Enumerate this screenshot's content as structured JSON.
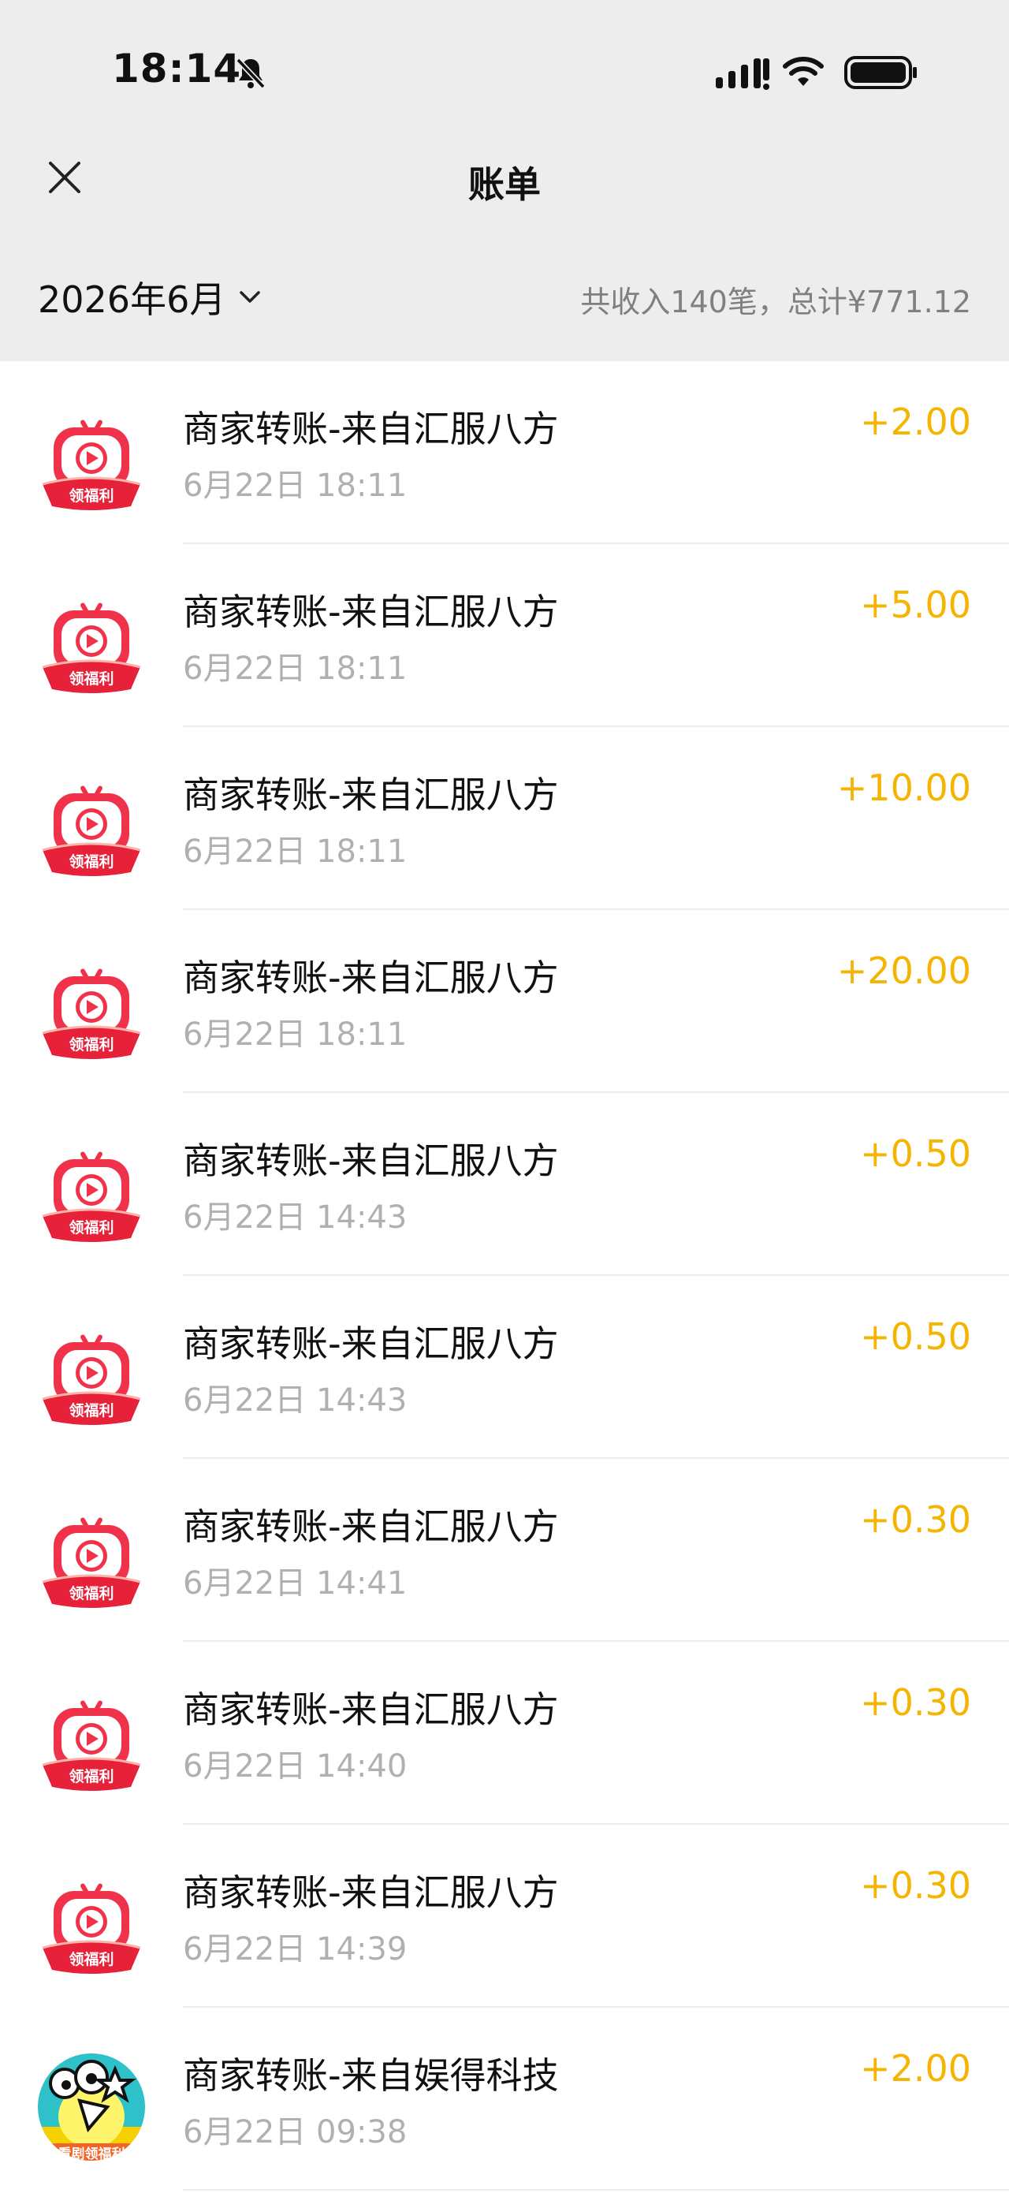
{
  "status_bar": {
    "time": "18:14"
  },
  "header": {
    "title": "账单"
  },
  "filter": {
    "month": "2026年6月",
    "summary": "共收入140笔，总计¥771.12"
  },
  "transactions": [
    {
      "title": "商家转账-来自汇服八方",
      "datetime": "6月22日 18:11",
      "amount": "+2.00",
      "avatar": "red-play-badge",
      "badge": "领福利"
    },
    {
      "title": "商家转账-来自汇服八方",
      "datetime": "6月22日 18:11",
      "amount": "+5.00",
      "avatar": "red-play-badge",
      "badge": "领福利"
    },
    {
      "title": "商家转账-来自汇服八方",
      "datetime": "6月22日 18:11",
      "amount": "+10.00",
      "avatar": "red-play-badge",
      "badge": "领福利"
    },
    {
      "title": "商家转账-来自汇服八方",
      "datetime": "6月22日 18:11",
      "amount": "+20.00",
      "avatar": "red-play-badge",
      "badge": "领福利"
    },
    {
      "title": "商家转账-来自汇服八方",
      "datetime": "6月22日 14:43",
      "amount": "+0.50",
      "avatar": "red-play-badge",
      "badge": "领福利"
    },
    {
      "title": "商家转账-来自汇服八方",
      "datetime": "6月22日 14:43",
      "amount": "+0.50",
      "avatar": "red-play-badge",
      "badge": "领福利"
    },
    {
      "title": "商家转账-来自汇服八方",
      "datetime": "6月22日 14:41",
      "amount": "+0.30",
      "avatar": "red-play-badge",
      "badge": "领福利"
    },
    {
      "title": "商家转账-来自汇服八方",
      "datetime": "6月22日 14:40",
      "amount": "+0.30",
      "avatar": "red-play-badge",
      "badge": "领福利"
    },
    {
      "title": "商家转账-来自汇服八方",
      "datetime": "6月22日 14:39",
      "amount": "+0.30",
      "avatar": "red-play-badge",
      "badge": "领福利"
    },
    {
      "title": "商家转账-来自娱得科技",
      "datetime": "6月22日 09:38",
      "amount": "+2.00",
      "avatar": "cartoon-bird",
      "badge": "看剧领福利"
    }
  ],
  "colors": {
    "amount": "#f4b400",
    "header_bg": "#ededed",
    "avatar_red": "#f0334b"
  },
  "icons": {
    "close": "close-icon",
    "mute": "bell-slash-icon",
    "signal": "cellular-signal-icon",
    "wifi": "wifi-icon",
    "battery": "battery-icon",
    "month_dropdown": "chevron-down-icon"
  }
}
